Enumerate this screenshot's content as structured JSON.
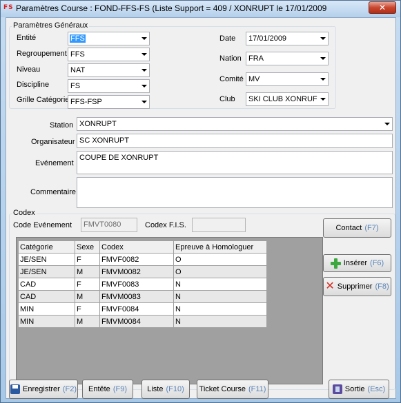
{
  "window": {
    "title": "Paramètres Course : FOND-FFS-FS (Liste Support = 409 / XONRUPT le 17/01/2009",
    "icon_text": "FS",
    "close_label": "✕"
  },
  "general": {
    "group_title": "Paramètres Généraux",
    "entite": {
      "label": "Entité",
      "value": "FFS"
    },
    "regroupement": {
      "label": "Regroupement",
      "value": "FFS"
    },
    "niveau": {
      "label": "Niveau",
      "value": "NAT"
    },
    "discipline": {
      "label": "Discipline",
      "value": "FS"
    },
    "grille": {
      "label": "Grille Catégorie",
      "value": "FFS-FSP"
    },
    "date": {
      "label": "Date",
      "value": "17/01/2009"
    },
    "nation": {
      "label": "Nation",
      "value": "FRA"
    },
    "comite": {
      "label": "Comité",
      "value": "MV"
    },
    "club": {
      "label": "Club",
      "value": "SKI CLUB XONRUF"
    }
  },
  "event": {
    "station": {
      "label": "Station",
      "value": "XONRUPT"
    },
    "organisateur": {
      "label": "Organisateur",
      "value": "SC XONRUPT"
    },
    "evenement": {
      "label": "Evénement",
      "value": "COUPE DE XONRUPT"
    },
    "commentaire": {
      "label": "Commentaire",
      "value": ""
    }
  },
  "codex": {
    "group_title": "Codex",
    "code_evenement_label": "Code Evénement",
    "code_evenement_value": "FMVT0080",
    "codex_fis_label": "Codex F.I.S.",
    "codex_fis_value": "",
    "contact_button": {
      "label": "Contact",
      "key": "(F7)"
    },
    "inserer_button": {
      "label": "Insérer",
      "key": "(F6)"
    },
    "supprimer_button": {
      "label": "Supprimer",
      "key": "(F8)"
    },
    "table": {
      "headers": [
        "Catégorie",
        "Sexe",
        "Codex",
        "Epreuve à Homologuer"
      ],
      "rows": [
        [
          "JE/SEN",
          "F",
          "FMVF0082",
          "O"
        ],
        [
          "JE/SEN",
          "M",
          "FMVM0082",
          "O"
        ],
        [
          "CAD",
          "F",
          "FMVF0083",
          "N"
        ],
        [
          "CAD",
          "M",
          "FMVM0083",
          "N"
        ],
        [
          "MIN",
          "F",
          "FMVF0084",
          "N"
        ],
        [
          "MIN",
          "M",
          "FMVM0084",
          "N"
        ]
      ]
    }
  },
  "footer": {
    "enregistrer": {
      "label": "Enregistrer",
      "key": "(F2)"
    },
    "entete": {
      "label": "Entête",
      "key": "(F9)"
    },
    "liste": {
      "label": "Liste",
      "key": "(F10)"
    },
    "ticket": {
      "label": "Ticket Course",
      "key": "(F11)"
    },
    "sortie": {
      "label": "Sortie",
      "key": "(Esc)"
    }
  }
}
